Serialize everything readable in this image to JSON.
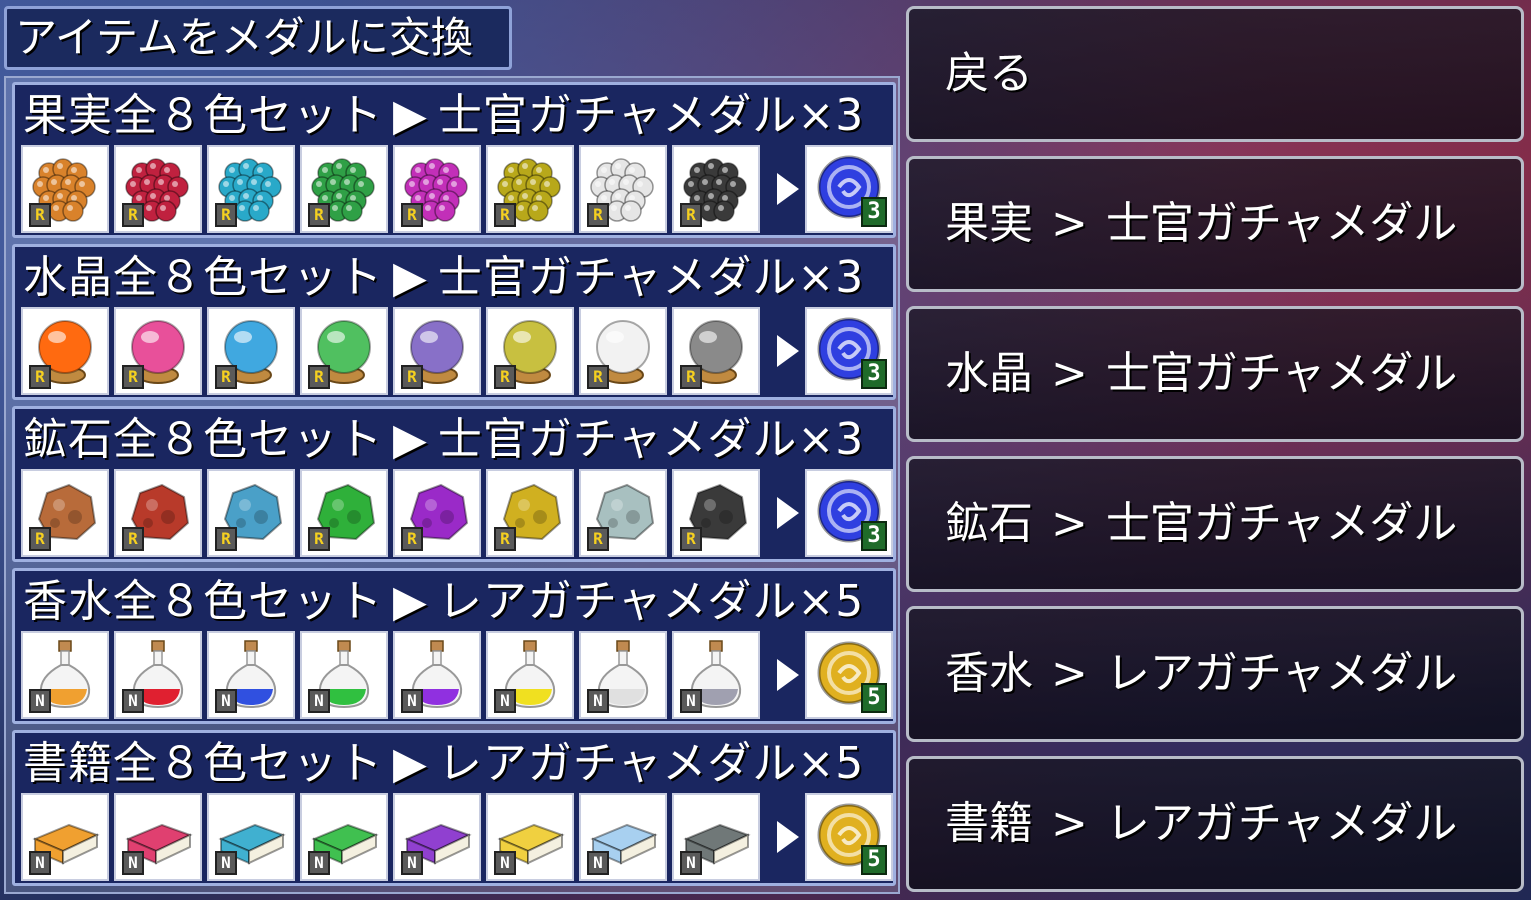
{
  "title": "アイテムをメダルに交換",
  "sets": [
    {
      "name": "果実全８色セット",
      "arrow": "▶",
      "reward": "士官ガチャメダル×3",
      "item_type": "fruit",
      "rank": "R",
      "colors": [
        "#d9822b",
        "#c0213f",
        "#29a9c9",
        "#2fa046",
        "#c22fb8",
        "#b8a81a",
        "#e6e6e6",
        "#3a3a3a"
      ],
      "medal": "blue",
      "medal_color": "#2f3fe0",
      "quantity": "3"
    },
    {
      "name": "水晶全８色セット",
      "arrow": "▶",
      "reward": "士官ガチャメダル×3",
      "item_type": "crystal",
      "rank": "R",
      "colors": [
        "#ff6a10",
        "#e8509a",
        "#40a8e0",
        "#50c060",
        "#8870c8",
        "#c8c040",
        "#f2f2f2",
        "#8a8a8a"
      ],
      "medal": "blue",
      "medal_color": "#2f3fe0",
      "quantity": "3"
    },
    {
      "name": "鉱石全８色セット",
      "arrow": "▶",
      "reward": "士官ガチャメダル×3",
      "item_type": "ore",
      "rank": "R",
      "colors": [
        "#b86b3a",
        "#b83a2a",
        "#4aa0c8",
        "#2fb03a",
        "#9a2ac8",
        "#d0b020",
        "#a8c0c0",
        "#3a3a3a"
      ],
      "medal": "blue",
      "medal_color": "#2f3fe0",
      "quantity": "3"
    },
    {
      "name": "香水全８色セット",
      "arrow": "▶",
      "reward": "レアガチャメダル×5",
      "item_type": "perfume",
      "rank": "N",
      "colors": [
        "#f0a030",
        "#e02030",
        "#3050e0",
        "#30c040",
        "#9030e0",
        "#f0e020",
        "#e0e0e0",
        "#a0a0b0"
      ],
      "medal": "gold",
      "medal_color": "#e0b020",
      "quantity": "5"
    },
    {
      "name": "書籍全８色セット",
      "arrow": "▶",
      "reward": "レアガチャメダル×5",
      "item_type": "book",
      "rank": "N",
      "colors": [
        "#f0a030",
        "#e04070",
        "#40b0d0",
        "#40c050",
        "#9040d0",
        "#f0d040",
        "#a8d0f0",
        "#707878"
      ],
      "medal": "gold",
      "medal_color": "#e0b020",
      "quantity": "5"
    }
  ],
  "menu": {
    "back": "戻る",
    "items": [
      {
        "label": "果実",
        "sep": ">",
        "target": "士官ガチャメダル"
      },
      {
        "label": "水晶",
        "sep": ">",
        "target": "士官ガチャメダル"
      },
      {
        "label": "鉱石",
        "sep": ">",
        "target": "士官ガチャメダル"
      },
      {
        "label": "香水",
        "sep": ">",
        "target": "レアガチャメダル"
      },
      {
        "label": "書籍",
        "sep": ">",
        "target": "レアガチャメダル"
      }
    ]
  }
}
